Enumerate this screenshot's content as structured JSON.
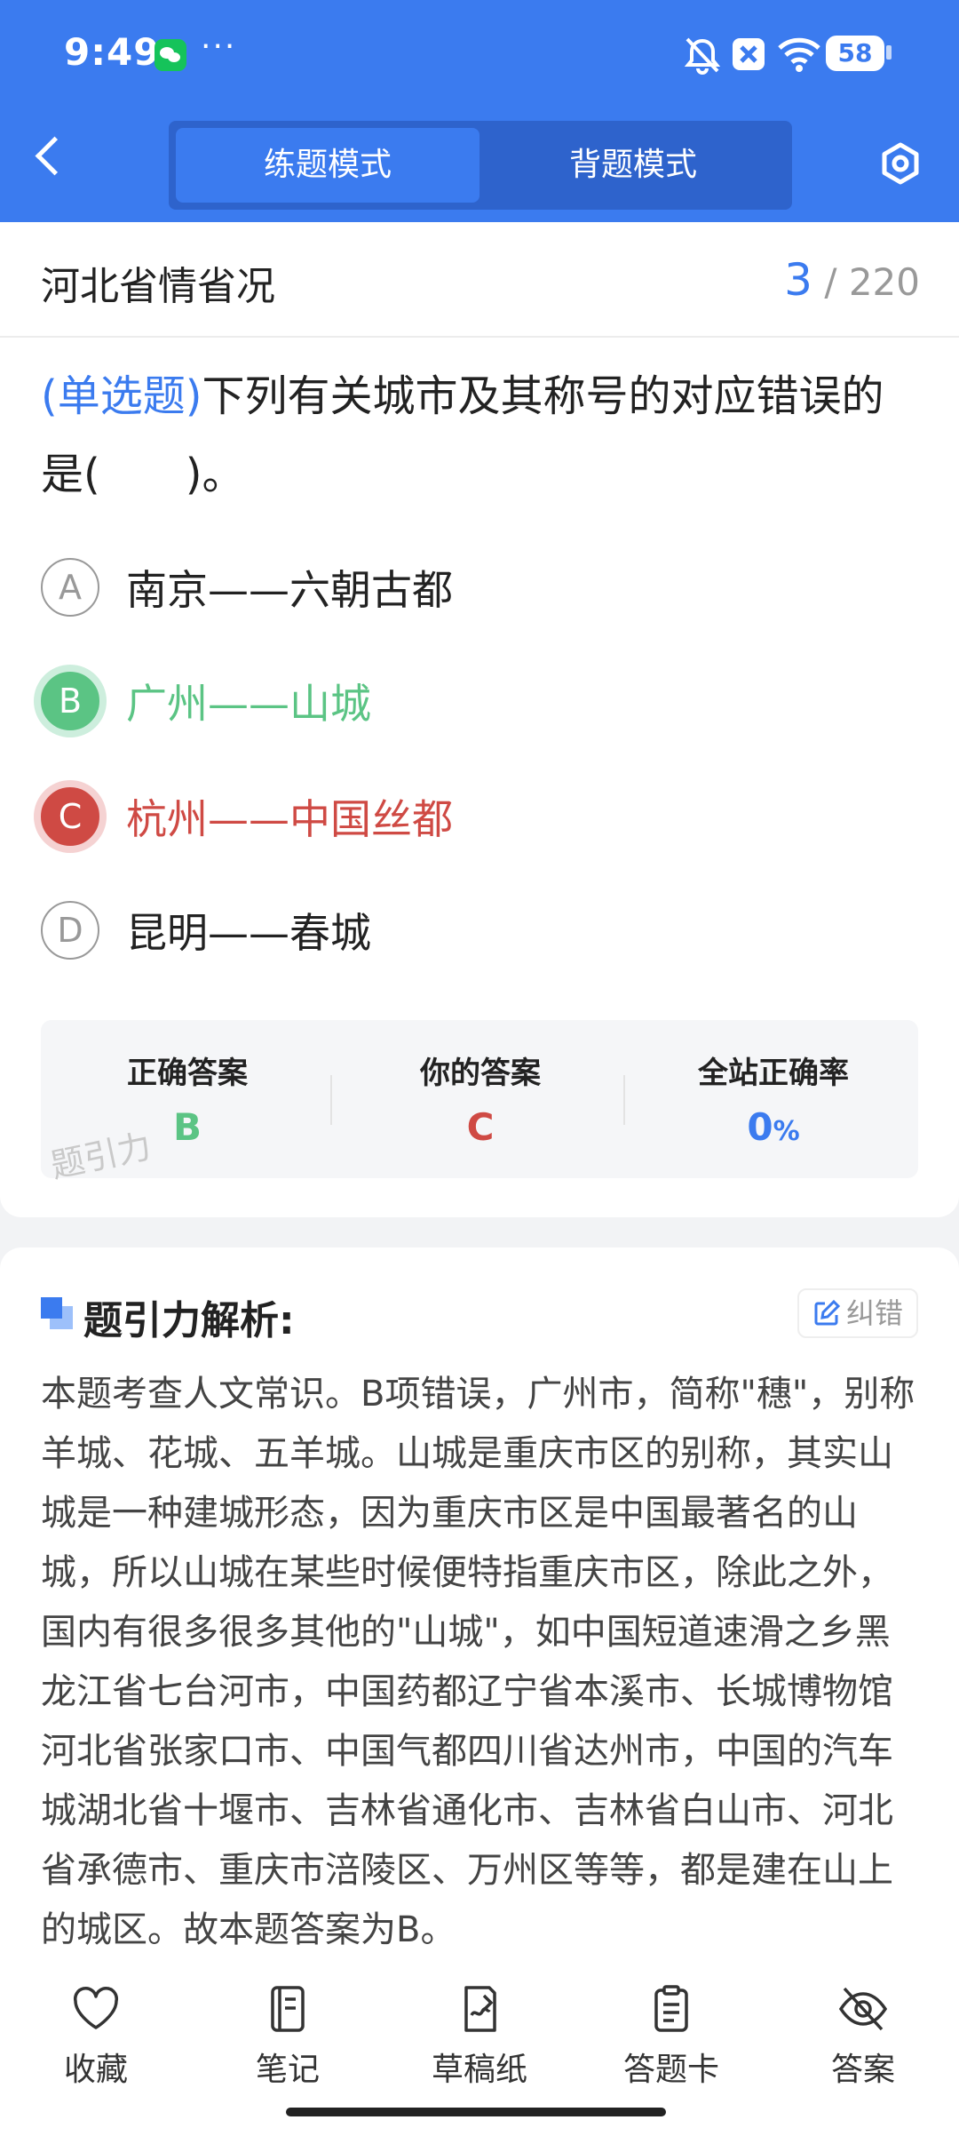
{
  "status_bar": {
    "time": "9:49",
    "more": "···",
    "battery": "58"
  },
  "header": {
    "mode_practice": "练题模式",
    "mode_recite": "背题模式"
  },
  "chapter": {
    "title": "河北省情省况",
    "current": "3",
    "total": "220",
    "separator": "/"
  },
  "question": {
    "type": "(单选题)",
    "text": "下列有关城市及其称号的对应错误的是(　　)。"
  },
  "options": [
    {
      "letter": "A",
      "text": "南京——六朝古都"
    },
    {
      "letter": "B",
      "text": "广州——山城"
    },
    {
      "letter": "C",
      "text": "杭州——中国丝都"
    },
    {
      "letter": "D",
      "text": "昆明——春城"
    }
  ],
  "result": {
    "correct_label": "正确答案",
    "correct_value": "B",
    "yours_label": "你的答案",
    "yours_value": "C",
    "rate_label": "全站正确率",
    "rate_value": "0",
    "rate_unit": "%",
    "watermark": "题引力"
  },
  "analysis": {
    "title": "题引力解析:",
    "fix_label": "纠错",
    "text": "本题考查人文常识。B项错误，广州市，简称\"穗\"，别称羊城、花城、五羊城。山城是重庆市区的别称，其实山城是一种建城形态，因为重庆市区是中国最著名的山城，所以山城在某些时候便特指重庆市区，除此之外，国内有很多很多其他的\"山城\"，如中国短道速滑之乡黑龙江省七台河市，中国药都辽宁省本溪市、长城博物馆河北省张家口市、中国气都四川省达州市，中国的汽车城湖北省十堰市、吉林省通化市、吉林省白山市、河北省承德市、重庆市涪陵区、万州区等等，都是建在山上的城区。故本题答案为B。"
  },
  "bottom_tabs": [
    {
      "label": "收藏",
      "icon": "heart-icon"
    },
    {
      "label": "笔记",
      "icon": "notebook-icon"
    },
    {
      "label": "草稿纸",
      "icon": "draft-paper-icon"
    },
    {
      "label": "答题卡",
      "icon": "answer-card-icon"
    },
    {
      "label": "答案",
      "icon": "eye-off-icon"
    }
  ],
  "colors": {
    "primary": "#3b7bef",
    "correct": "#5bc484",
    "wrong": "#cf4a44"
  }
}
